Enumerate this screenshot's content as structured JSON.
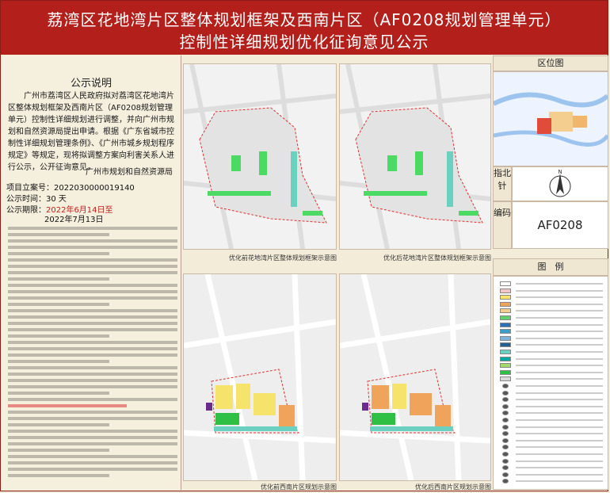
{
  "title": {
    "line1": "荔湾区花地湾片区整体规划框架及西南片区（AF0208规划管理单元）",
    "line2": "控制性详细规划优化征询意见公示"
  },
  "notice": {
    "heading": "公示说明",
    "paragraph": "广州市荔湾区人民政府拟对荔湾区花地湾片区整体规划框架及西南片区（AF0208规划管理单元）控制性详细规划进行调整，并向广州市规划和自然资源局提出申请。根据《广东省城市控制性详细规划管理条例》、《广州市城乡规划程序规定》等规定，现将拟调整方案向利害关系人进行公示，公开征询意见。",
    "signature": "广州市规划和自然资源局",
    "project_label": "项目立案号：",
    "project_no": "2022030000019140",
    "duration_label": "公示时间：",
    "duration": "30 天",
    "period_label": "公示期限：",
    "period_start": "2022年6月14日至",
    "period_end": "2022年7月13日"
  },
  "panels": {
    "top_left_caption": "优化前花地湾片区整体规划框架示意图",
    "top_right_caption": "优化后花地湾片区整体规划框架示意图",
    "bottom_left_caption": "优化前西南片区规划示意图",
    "bottom_right_caption": "优化后西南片区规划示意图"
  },
  "side": {
    "location_heading": "区位图",
    "compass_label": "指北针",
    "compass_letter": "N",
    "code_label": "编码",
    "code_value": "AF0208",
    "legend_heading": "图　例"
  },
  "legend_colors": [
    "#ffffff",
    "#f2c6c6",
    "#f5e36b",
    "#f0a35a",
    "#f3ce8f",
    "#5fd06a",
    "#2e6fb3",
    "#3a9ec5",
    "#7fb3d9",
    "#25618e",
    "#6bd0c0",
    "#00a6a0",
    "#a4d86b",
    "#2fbf45",
    "#d9d9d9"
  ],
  "colors": {
    "title_red": "#b3201c",
    "accent_red": "#c0201c"
  }
}
